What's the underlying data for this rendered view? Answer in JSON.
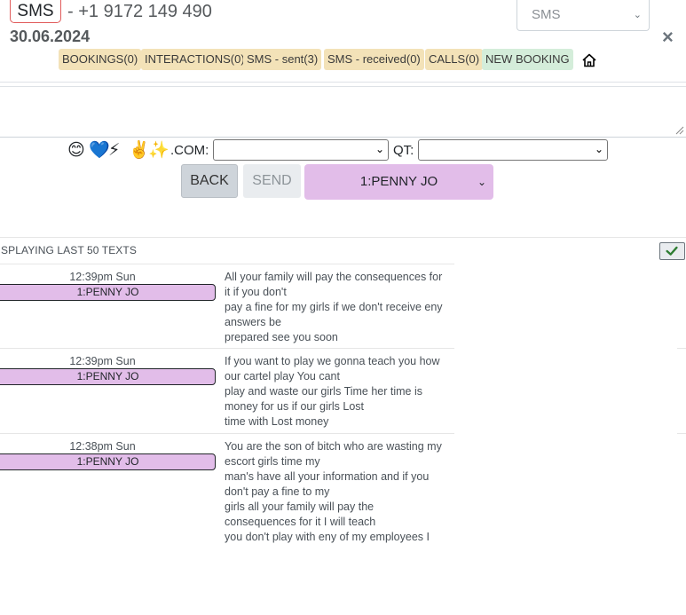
{
  "header": {
    "channel_badge": "SMS",
    "phone": "- +1 9172 149 490",
    "date": "30.06.2024",
    "type_select_value": "SMS",
    "close_symbol": "×"
  },
  "tabs": [
    {
      "label": "BOOKINGS(0)",
      "color": "#f3e2b8"
    },
    {
      "label": "INTERACTIONS(0)",
      "color": "#f3e2b8"
    },
    {
      "label": "SMS - sent(3)",
      "color": "#f3e2b8"
    },
    {
      "label": "SMS - received(0)",
      "color": "#f3e2b8"
    },
    {
      "label": "CALLS(0)",
      "color": "#f3e2b8"
    },
    {
      "label": "NEW BOOKING",
      "color": "#d4edda"
    }
  ],
  "toolbar": {
    "emojis": [
      "😊",
      "💙",
      "⚡",
      "✌️",
      "✨"
    ],
    "com_label": ".COM:",
    "qt_label": "QT:",
    "back_label": "BACK",
    "send_label": "SEND",
    "agent_select_value": "1:PENNY JO"
  },
  "history": {
    "label": "SPLAYING LAST 50 TEXTS",
    "messages": [
      {
        "time": "12:39pm Sun",
        "agent": "1:PENNY JO",
        "lines": [
          "All your family will pay the consequences for",
          "it if you don't",
          "pay a fine for my girls if we don't receive eny",
          "answers be",
          "prepared see you soon"
        ]
      },
      {
        "time": "12:39pm Sun",
        "agent": "1:PENNY JO",
        "lines": [
          "If you want to play we gonna teach you how",
          "our cartel play You cant",
          "play and waste our girls Time her time is",
          "money for us if our girls Lost",
          "time with Lost money"
        ]
      },
      {
        "time": "12:38pm Sun",
        "agent": "1:PENNY JO",
        "lines": [
          "You are the son of bitch who are wasting my",
          "escort girls time my",
          "man's have all your information and if you",
          "don't pay a fine to my",
          "girls all your family will pay the",
          "consequences for it I will teach",
          "you don't play with eny of my employees I"
        ]
      }
    ]
  },
  "colors": {
    "agent_purple": "#e2bde9",
    "tab_tan": "#f3e2b8",
    "tab_green": "#d4edda",
    "badge_border": "#e05b5b"
  }
}
